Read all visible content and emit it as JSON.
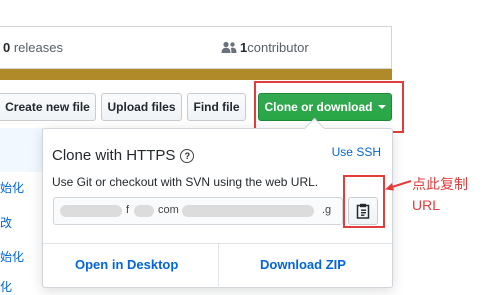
{
  "stats": {
    "releases_count": "0",
    "releases_label": " releases",
    "contributors_count": "1",
    "contributors_label": " contributor"
  },
  "colors": {
    "language_bar": "#b08a29",
    "primary_button": "#28a745",
    "annotation": "#e23d3d",
    "link": "#0366d6"
  },
  "toolbar": {
    "create_new_file": "Create new file",
    "upload_files": "Upload files",
    "find_file": "Find file",
    "clone_or_download": "Clone or download"
  },
  "file_list": {
    "visible_fragments": [
      "始化",
      "改",
      "始化",
      "化"
    ]
  },
  "clone_popover": {
    "title": "Clone with HTTPS",
    "help_icon": "question-circle-icon",
    "use_ssh": "Use SSH",
    "description": "Use Git or checkout with SVN using the web URL.",
    "url_visible_parts": [
      "f",
      "com",
      ".g"
    ],
    "copy_icon": "clipboard-icon",
    "open_in_desktop": "Open in Desktop",
    "download_zip": "Download ZIP"
  },
  "annotation": {
    "line1": "点此复制",
    "line2": "URL"
  }
}
